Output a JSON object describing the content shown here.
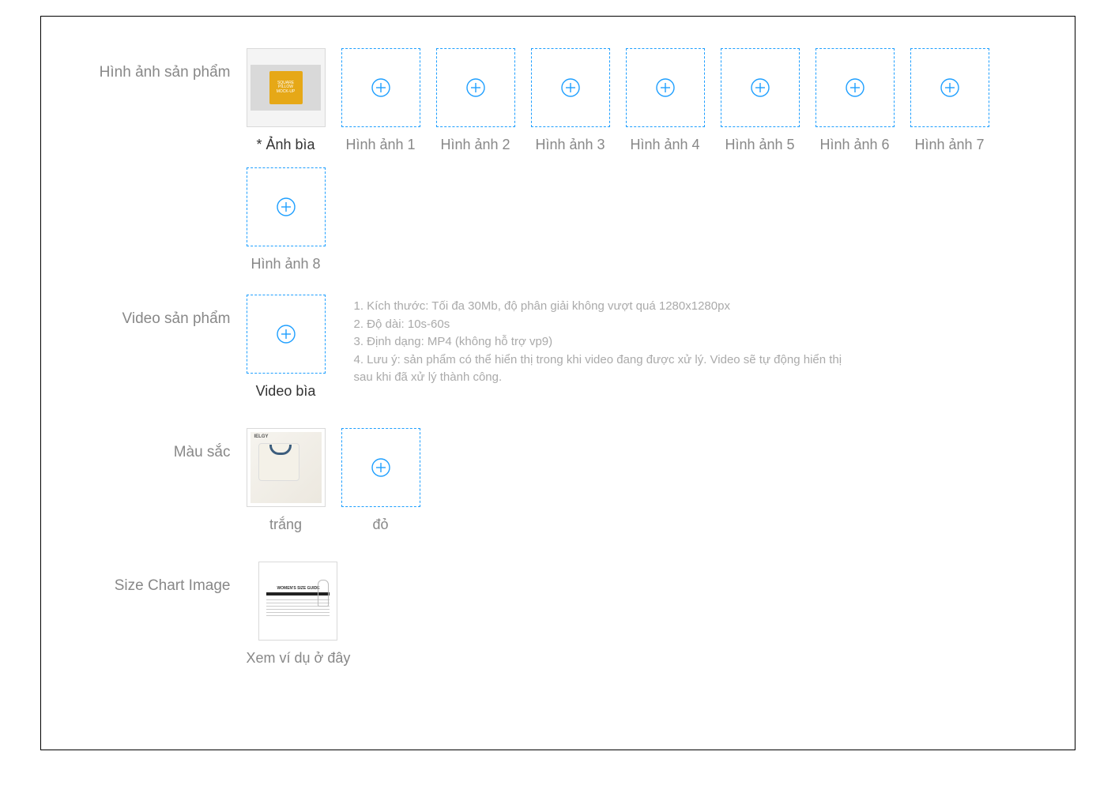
{
  "sections": {
    "product_images": {
      "label": "Hình ảnh sản phẩm",
      "slots": [
        {
          "label": "* Ảnh bìa",
          "filled": true,
          "dark": true
        },
        {
          "label": "Hình ảnh 1",
          "filled": false
        },
        {
          "label": "Hình ảnh 2",
          "filled": false
        },
        {
          "label": "Hình ảnh 3",
          "filled": false
        },
        {
          "label": "Hình ảnh 4",
          "filled": false
        },
        {
          "label": "Hình ảnh 5",
          "filled": false
        },
        {
          "label": "Hình ảnh 6",
          "filled": false
        },
        {
          "label": "Hình ảnh 7",
          "filled": false
        },
        {
          "label": "Hình ảnh 8",
          "filled": false
        }
      ]
    },
    "product_video": {
      "label": "Video sản phẩm",
      "slot_label": "Video bìa",
      "hints": [
        "1. Kích thước: Tối đa 30Mb, độ phân giải không vượt quá 1280x1280px",
        "2. Độ dài: 10s-60s",
        "3. Định dạng: MP4 (không hỗ trợ vp9)",
        "4. Lưu ý: sản phẩm có thể hiển thị trong khi video đang được xử lý. Video sẽ tự động hiển thị sau khi đã xử lý thành công."
      ]
    },
    "color": {
      "label": "Màu sắc",
      "items": [
        {
          "label": "trắng",
          "filled": true
        },
        {
          "label": "đỏ",
          "filled": false
        }
      ]
    },
    "size_chart": {
      "label": "Size Chart Image",
      "link_text": "Xem ví dụ ở đây"
    }
  }
}
